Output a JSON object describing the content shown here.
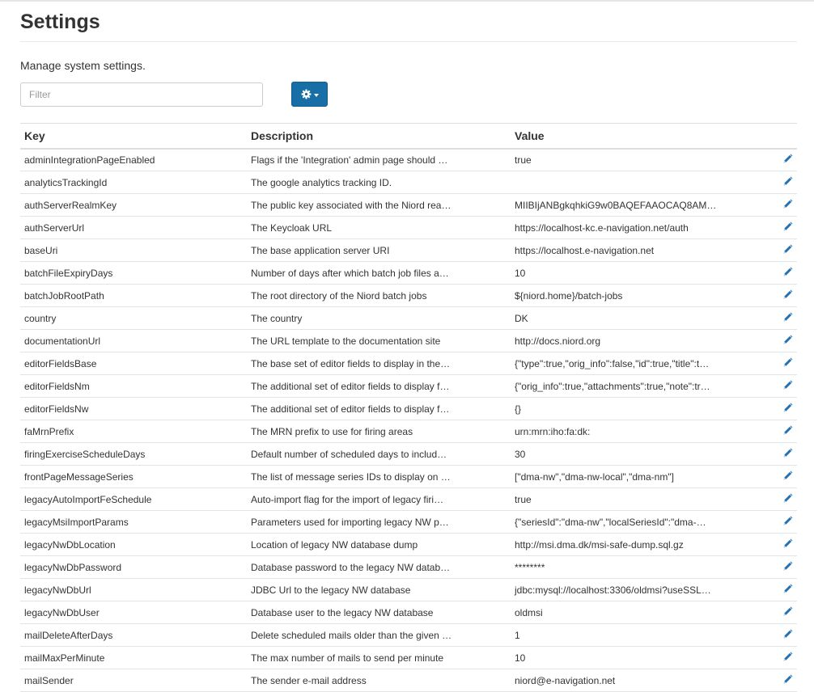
{
  "page": {
    "title": "Settings",
    "subtitle": "Manage system settings."
  },
  "filter": {
    "placeholder": "Filter",
    "value": ""
  },
  "actions": {
    "menu_icon": "gear-icon",
    "menu_indicator": "caret-down-icon",
    "accent_color": "#186fa5"
  },
  "table": {
    "columns": [
      "Key",
      "Description",
      "Value"
    ],
    "row_action_icon": "pencil-icon",
    "rows": [
      {
        "key": "adminIntegrationPageEnabled",
        "description": "Flags if the 'Integration' admin page should …",
        "value": "true"
      },
      {
        "key": "analyticsTrackingId",
        "description": "The google analytics tracking ID.",
        "value": ""
      },
      {
        "key": "authServerRealmKey",
        "description": "The public key associated with the Niord rea…",
        "value": "MIIBIjANBgkqhkiG9w0BAQEFAAOCAQ8AM…"
      },
      {
        "key": "authServerUrl",
        "description": "The Keycloak URL",
        "value": "https://localhost-kc.e-navigation.net/auth"
      },
      {
        "key": "baseUri",
        "description": "The base application server URI",
        "value": "https://localhost.e-navigation.net"
      },
      {
        "key": "batchFileExpiryDays",
        "description": "Number of days after which batch job files a…",
        "value": "10"
      },
      {
        "key": "batchJobRootPath",
        "description": "The root directory of the Niord batch jobs",
        "value": "${niord.home}/batch-jobs"
      },
      {
        "key": "country",
        "description": "The country",
        "value": "DK"
      },
      {
        "key": "documentationUrl",
        "description": "The URL template to the documentation site",
        "value": "http://docs.niord.org"
      },
      {
        "key": "editorFieldsBase",
        "description": "The base set of editor fields to display in the…",
        "value": "{\"type\":true,\"orig_info\":false,\"id\":true,\"title\":t…"
      },
      {
        "key": "editorFieldsNm",
        "description": "The additional set of editor fields to display f…",
        "value": "{\"orig_info\":true,\"attachments\":true,\"note\":tr…"
      },
      {
        "key": "editorFieldsNw",
        "description": "The additional set of editor fields to display f…",
        "value": "{}"
      },
      {
        "key": "faMrnPrefix",
        "description": "The MRN prefix to use for firing areas",
        "value": "urn:mrn:iho:fa:dk:"
      },
      {
        "key": "firingExerciseScheduleDays",
        "description": "Default number of scheduled days to includ…",
        "value": "30"
      },
      {
        "key": "frontPageMessageSeries",
        "description": "The list of message series IDs to display on …",
        "value": "[\"dma-nw\",\"dma-nw-local\",\"dma-nm\"]"
      },
      {
        "key": "legacyAutoImportFeSchedule",
        "description": "Auto-import flag for the import of legacy firi…",
        "value": "true"
      },
      {
        "key": "legacyMsiImportParams",
        "description": "Parameters used for importing legacy NW p…",
        "value": "{\"seriesId\":\"dma-nw\",\"localSeriesId\":\"dma-…"
      },
      {
        "key": "legacyNwDbLocation",
        "description": "Location of legacy NW database dump",
        "value": "http://msi.dma.dk/msi-safe-dump.sql.gz"
      },
      {
        "key": "legacyNwDbPassword",
        "description": "Database password to the legacy NW datab…",
        "value": "********"
      },
      {
        "key": "legacyNwDbUrl",
        "description": "JDBC Url to the legacy NW database",
        "value": "jdbc:mysql://localhost:3306/oldmsi?useSSL…"
      },
      {
        "key": "legacyNwDbUser",
        "description": "Database user to the legacy NW database",
        "value": "oldmsi"
      },
      {
        "key": "mailDeleteAfterDays",
        "description": "Delete scheduled mails older than the given …",
        "value": "1"
      },
      {
        "key": "mailMaxPerMinute",
        "description": "The max number of mails to send per minute",
        "value": "10"
      },
      {
        "key": "mailSender",
        "description": "The sender e-mail address",
        "value": "niord@e-navigation.net"
      }
    ]
  }
}
